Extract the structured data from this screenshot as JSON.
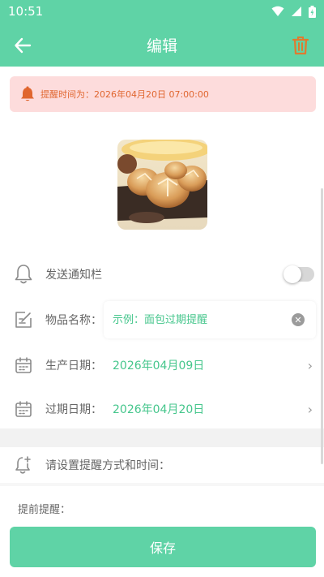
{
  "status_bar": {
    "time": "10:51"
  },
  "app_bar": {
    "title": "编辑"
  },
  "alert": {
    "text": "提醒时间为：2026年04月20日 07:00:00"
  },
  "notify": {
    "label": "发送通知栏",
    "enabled": false
  },
  "item_name": {
    "label": "物品名称：",
    "placeholder": "示例：面包过期提醒",
    "value": ""
  },
  "production_date": {
    "label": "生产日期：",
    "value": "2026年04月09日"
  },
  "expiry_date": {
    "label": "过期日期：",
    "value": "2026年04月20日"
  },
  "reminder_section": {
    "title": "请设置提醒方式和时间："
  },
  "advance": {
    "label": "提前提醒："
  },
  "save": {
    "label": "保存"
  },
  "colors": {
    "primary": "#5fd3a6",
    "accent_text": "#45c68c",
    "alert_bg": "#fddcdc",
    "alert_text": "#e0662f",
    "trash": "#e07a2f"
  },
  "icons": [
    "back-arrow-icon",
    "trash-icon",
    "bell-icon",
    "edit-icon",
    "calendar-icon",
    "bell-plus-icon",
    "clear-icon",
    "chevron-right-icon"
  ]
}
